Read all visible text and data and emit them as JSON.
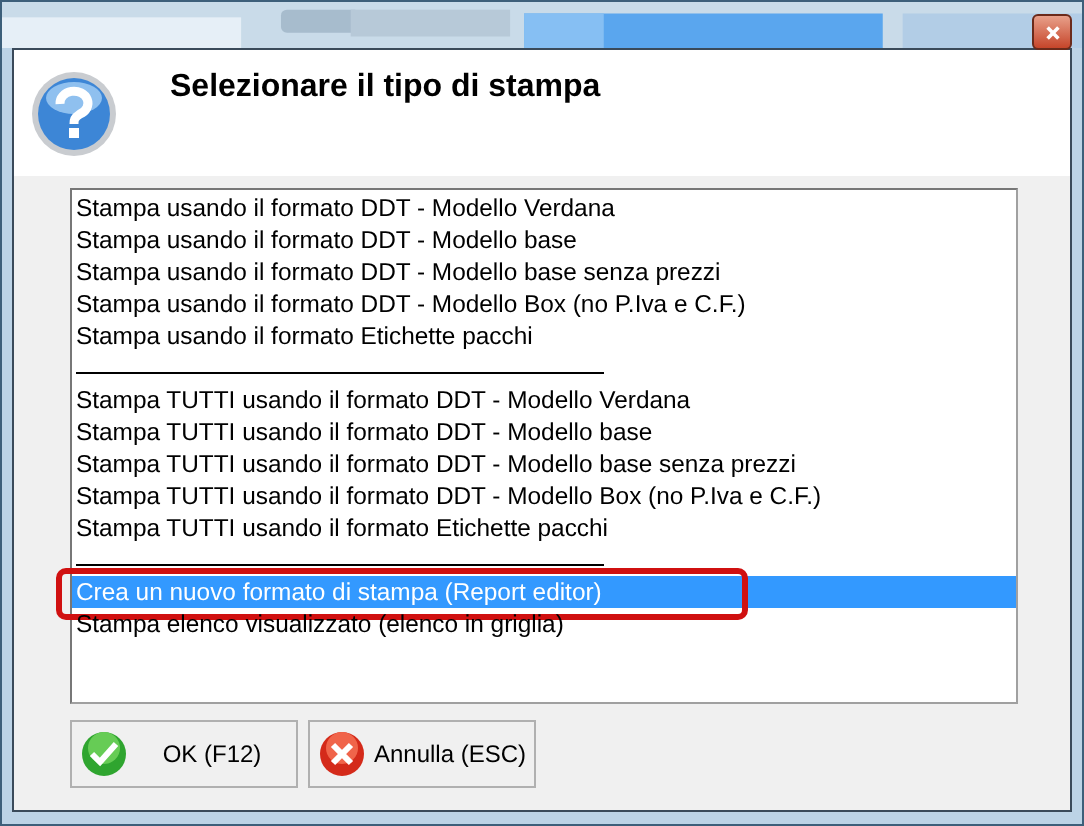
{
  "header": {
    "title": "Selezionare il tipo di stampa"
  },
  "list": {
    "items": [
      {
        "kind": "option",
        "label": "Stampa usando il formato DDT - Modello Verdana",
        "selected": false,
        "annotated": false
      },
      {
        "kind": "option",
        "label": "Stampa usando il formato DDT - Modello base",
        "selected": false,
        "annotated": false
      },
      {
        "kind": "option",
        "label": "Stampa usando il formato DDT - Modello base senza prezzi",
        "selected": false,
        "annotated": false
      },
      {
        "kind": "option",
        "label": "Stampa usando il formato DDT - Modello Box (no P.Iva e C.F.)",
        "selected": false,
        "annotated": false
      },
      {
        "kind": "option",
        "label": "Stampa usando il formato Etichette pacchi",
        "selected": false,
        "annotated": false
      },
      {
        "kind": "separator"
      },
      {
        "kind": "option",
        "label": "Stampa TUTTI usando il formato DDT - Modello Verdana",
        "selected": false,
        "annotated": false
      },
      {
        "kind": "option",
        "label": "Stampa TUTTI usando il formato DDT - Modello base",
        "selected": false,
        "annotated": false
      },
      {
        "kind": "option",
        "label": "Stampa TUTTI usando il formato DDT - Modello base senza prezzi",
        "selected": false,
        "annotated": false
      },
      {
        "kind": "option",
        "label": "Stampa TUTTI usando il formato DDT - Modello Box (no P.Iva e C.F.)",
        "selected": false,
        "annotated": false
      },
      {
        "kind": "option",
        "label": "Stampa TUTTI usando il formato Etichette pacchi",
        "selected": false,
        "annotated": false
      },
      {
        "kind": "separator"
      },
      {
        "kind": "option",
        "label": "Crea un nuovo formato di stampa (Report editor)",
        "selected": true,
        "annotated": true
      },
      {
        "kind": "option",
        "label": "Stampa elenco visualizzato (elenco in griglia)",
        "selected": false,
        "annotated": false
      }
    ]
  },
  "buttons": [
    {
      "kind": "ok",
      "label": "OK (F12)"
    },
    {
      "kind": "cancel",
      "label": "Annulla (ESC)"
    }
  ]
}
